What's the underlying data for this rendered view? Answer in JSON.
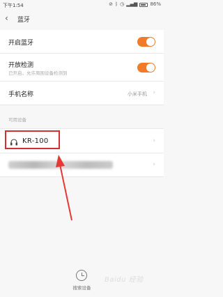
{
  "status_bar": {
    "time": "下午1:54",
    "battery": "86%",
    "icons": [
      "mute-icon",
      "bluetooth-icon",
      "alarm-icon",
      "signal-icon",
      "battery-icon"
    ]
  },
  "header": {
    "back_icon": "chevron-left-icon",
    "title": "蓝牙"
  },
  "settings": {
    "bluetooth_toggle": {
      "label": "开启蓝牙",
      "enabled": true
    },
    "discoverable_toggle": {
      "label": "开放检测",
      "sublabel": "已开启，允许周围设备检测到",
      "enabled": true
    },
    "device_name": {
      "label": "手机名称",
      "value": "小米手机"
    }
  },
  "available_devices": {
    "section_label": "可用设备",
    "items": [
      {
        "name": "KR-100",
        "icon": "headphones-icon"
      },
      {
        "name": "",
        "blurred": true
      }
    ]
  },
  "scan": {
    "label": "搜索设备",
    "icon": "scan-icon"
  },
  "watermark": "Baidu 经验",
  "colors": {
    "toggle_on": "#f07b2a",
    "highlight": "#d32f2f",
    "arrow": "#e53935"
  }
}
